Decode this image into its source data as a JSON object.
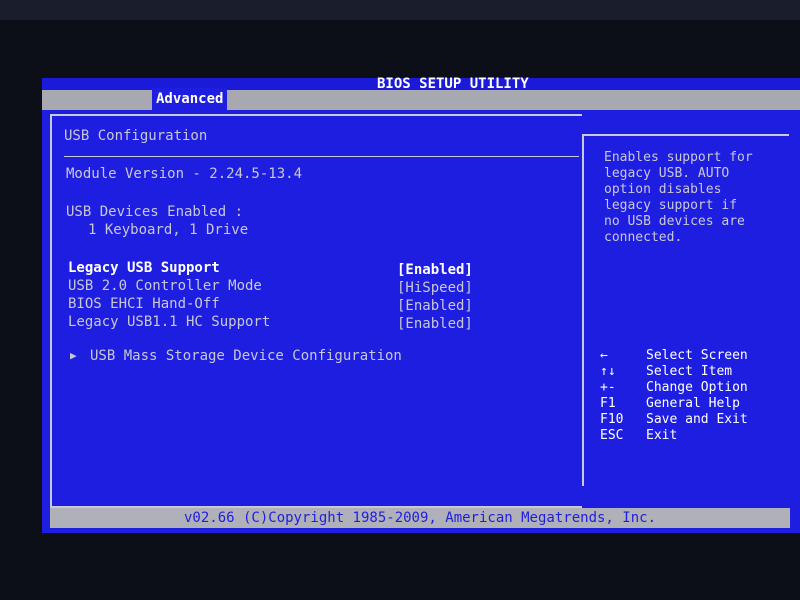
{
  "header": {
    "title": "BIOS SETUP UTILITY",
    "active_tab": "Advanced"
  },
  "main": {
    "section_title": "USB Configuration",
    "module_version": "Module Version - 2.24.5-13.4",
    "devices_label": "USB Devices Enabled :",
    "devices_value": "1 Keyboard, 1 Drive",
    "settings": [
      {
        "label": "Legacy USB Support",
        "value": "[Enabled]"
      },
      {
        "label": "USB 2.0 Controller Mode",
        "value": "[HiSpeed]"
      },
      {
        "label": "BIOS EHCI Hand-Off",
        "value": "[Enabled]"
      },
      {
        "label": "Legacy USB1.1 HC Support",
        "value": "[Enabled]"
      }
    ],
    "submenu": "USB Mass Storage Device Configuration",
    "submenu_marker": "▶"
  },
  "help": {
    "text": "Enables support for\nlegacy USB. AUTO\noption disables\nlegacy support if\nno USB devices are\nconnected.",
    "keys": [
      {
        "key": "←",
        "action": "Select Screen"
      },
      {
        "key": "↑↓",
        "action": "Select Item"
      },
      {
        "key": "+-",
        "action": "Change Option"
      },
      {
        "key": "F1",
        "action": "General Help"
      },
      {
        "key": "F10",
        "action": "Save and Exit"
      },
      {
        "key": "ESC",
        "action": "Exit"
      }
    ]
  },
  "footer": {
    "copyright": "v02.66 (C)Copyright 1985-2009, American Megatrends, Inc."
  },
  "colors": {
    "background": "#1e1ee0",
    "text": "#c8c8d8",
    "highlight": "#ffffff",
    "bar": "#a8a8b0"
  }
}
